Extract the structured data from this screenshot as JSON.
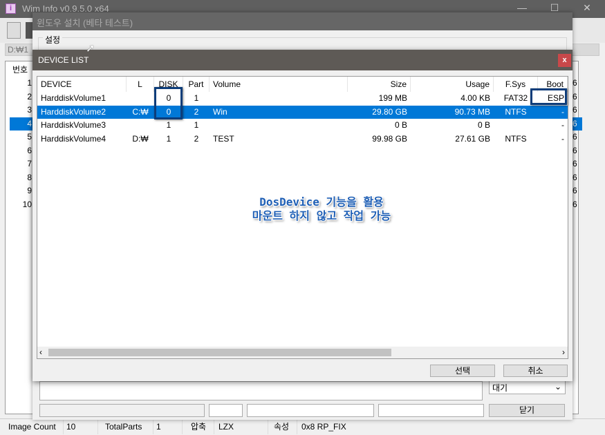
{
  "main_window": {
    "title": "Wim Info v0.9.5.0 x64",
    "path": "D:₩1",
    "list_header": "번호",
    "rows": [
      "1",
      "2",
      "3",
      "4",
      "5",
      "6",
      "7",
      "8",
      "9",
      "10"
    ],
    "selected_row": 4,
    "right_values": [
      "6",
      "6",
      "6",
      "6",
      "6",
      "6",
      "6",
      "6",
      "6",
      "6"
    ]
  },
  "status_bar": {
    "image_count_label": "Image Count",
    "image_count": "10",
    "total_parts_label": "TotalParts",
    "total_parts": "1",
    "compression_label": "압축",
    "compression": "LZX",
    "attr_label": "속성",
    "attr": "0x8 RP_FIX"
  },
  "install_dialog": {
    "title": "윈도우 설치 (베타 테스트)",
    "group_label": "설정",
    "state_combo": "대기",
    "close_button": "닫기"
  },
  "device_list": {
    "title": "DEVICE LIST",
    "close": "x",
    "columns": [
      "DEVICE",
      "L",
      "DISK",
      "Part",
      "Volume",
      "Size",
      "Usage",
      "F.Sys",
      "Boot"
    ],
    "rows": [
      [
        "HarddiskVolume1",
        "",
        "0",
        "1",
        "",
        "199 MB",
        "4.00 KB",
        "FAT32",
        "ESP"
      ],
      [
        "HarddiskVolume2",
        "C:₩",
        "0",
        "2",
        "Win",
        "29.80 GB",
        "90.73 MB",
        "NTFS",
        "-"
      ],
      [
        "HarddiskVolume3",
        "",
        "1",
        "1",
        "",
        "0 B",
        "0 B",
        "",
        "-"
      ],
      [
        "HarddiskVolume4",
        "D:₩",
        "1",
        "2",
        "TEST",
        "99.98 GB",
        "27.61 GB",
        "NTFS",
        "-"
      ]
    ],
    "selected_row": 2,
    "select_button": "선택",
    "cancel_button": "취소"
  },
  "annotation": {
    "line1": "DosDevice 기능을 활용",
    "line2": "마운트 하지 않고 작업 가능",
    "highlight_color": "#0d3d7a"
  },
  "colors": {
    "selection": "#0078d7",
    "close_button": "#c9484a"
  }
}
